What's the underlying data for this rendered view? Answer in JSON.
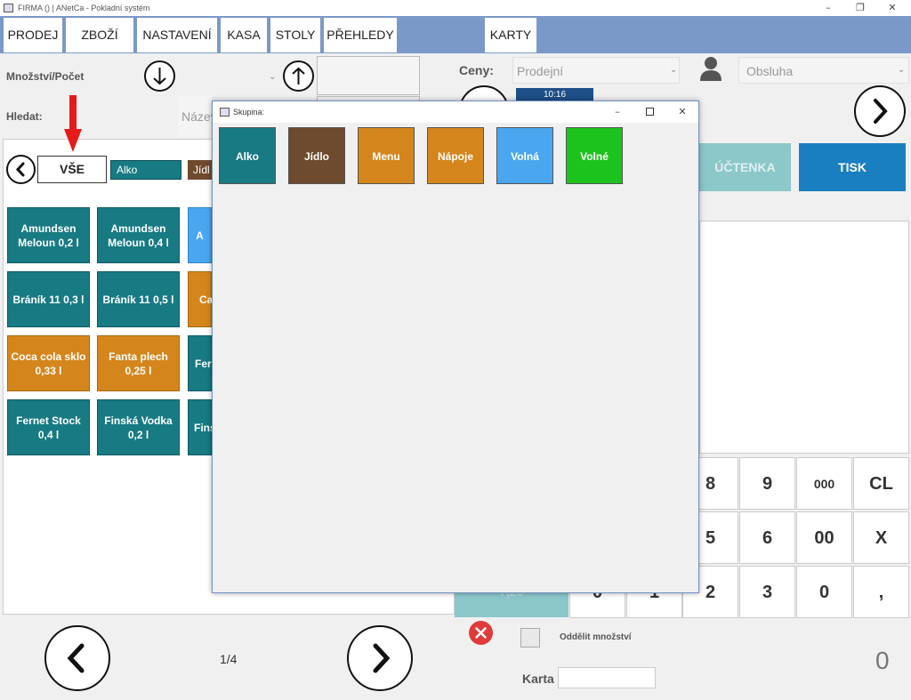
{
  "window": {
    "title": "FIRMA () | ANetCa - Pokladní systém",
    "minimize": "–",
    "restore": "❐",
    "close": "✕"
  },
  "menu": [
    "PRODEJ",
    "ZBOŽÍ",
    "NASTAVENÍ",
    "KASA",
    "STOLY",
    "PŘEHLEDY",
    "KARTY"
  ],
  "top": {
    "qty_label": "Množství/Počet",
    "search_label": "Hledat:",
    "search_placeholder": "Název",
    "prices_label": "Ceny:",
    "prices_value": "Prodejní",
    "staff_value": "Obsluha",
    "time": "10:16"
  },
  "categories": {
    "all": "VŠE",
    "alko": "Alko",
    "jidlo": "Jídl"
  },
  "products": [
    [
      "Amundsen Meloun 0,2 l",
      "Amundsen Meloun 0,4 l",
      "A"
    ],
    [
      "Bráník 11 0,3 l",
      "Bráník 11 0,5 l",
      "Ca"
    ],
    [
      "Coca cola sklo 0,33 l",
      "Fanta plech 0,25 l",
      "Fer"
    ],
    [
      "Fernet Stock 0,4 l",
      "Finská Vodka 0,2 l",
      "Fins"
    ]
  ],
  "actions": {
    "receipt": "ÚČTENKA",
    "print": "TISK"
  },
  "keypad": {
    "row1": [
      "8",
      "9",
      "000",
      "CL"
    ],
    "row2": [
      "5",
      "6",
      "00",
      "X"
    ],
    "row3": [
      "2",
      "3",
      "0",
      ","
    ],
    "partial": [
      "0",
      "1"
    ]
  },
  "bottom": {
    "page": "1/4",
    "split_qty": "Oddělit množství",
    "card_label": "Karta",
    "total": "0",
    "hidden_btn": "7,20"
  },
  "dialog": {
    "title": "Skupina:",
    "groups": [
      {
        "label": "Alko",
        "color": "#187a83"
      },
      {
        "label": "Jídlo",
        "color": "#6e4a2e"
      },
      {
        "label": "Menu",
        "color": "#d4861c"
      },
      {
        "label": "Nápoje",
        "color": "#d4861c"
      },
      {
        "label": "Volná",
        "color": "#4aa7ef"
      },
      {
        "label": "Volné",
        "color": "#1dc31d"
      }
    ]
  },
  "colors": {
    "menubar": "#7b99c8",
    "teal": "#187a83",
    "print": "#1a7fc0",
    "receipt_btn": "#8cc7c9"
  }
}
